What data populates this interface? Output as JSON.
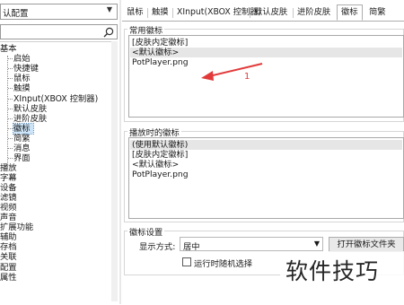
{
  "preset": {
    "value": "认配置"
  },
  "search": {
    "placeholder": ""
  },
  "tree": [
    {
      "label": "基本",
      "indent": 0,
      "sel": false
    },
    {
      "label": "启始",
      "indent": 1,
      "sel": false
    },
    {
      "label": "快捷键",
      "indent": 1,
      "sel": false
    },
    {
      "label": "鼠标",
      "indent": 1,
      "sel": false
    },
    {
      "label": "触摸",
      "indent": 1,
      "sel": false
    },
    {
      "label": "XInput(XBOX 控制器)",
      "indent": 1,
      "sel": false
    },
    {
      "label": "默认皮肤",
      "indent": 1,
      "sel": false
    },
    {
      "label": "进阶皮肤",
      "indent": 1,
      "sel": false
    },
    {
      "label": "徽标",
      "indent": 1,
      "sel": true
    },
    {
      "label": "简繁",
      "indent": 1,
      "sel": false
    },
    {
      "label": "消息",
      "indent": 1,
      "sel": false
    },
    {
      "label": "界面",
      "indent": 1,
      "sel": false
    },
    {
      "label": "播放",
      "indent": 0,
      "sel": false
    },
    {
      "label": "字幕",
      "indent": 0,
      "sel": false
    },
    {
      "label": "设备",
      "indent": 0,
      "sel": false
    },
    {
      "label": "滤镜",
      "indent": 0,
      "sel": false
    },
    {
      "label": "视频",
      "indent": 0,
      "sel": false
    },
    {
      "label": "声音",
      "indent": 0,
      "sel": false
    },
    {
      "label": "扩展功能",
      "indent": 0,
      "sel": false
    },
    {
      "label": "辅助",
      "indent": 0,
      "sel": false
    },
    {
      "label": "存档",
      "indent": 0,
      "sel": false
    },
    {
      "label": "关联",
      "indent": 0,
      "sel": false
    },
    {
      "label": "配置",
      "indent": 0,
      "sel": false
    },
    {
      "label": "属性",
      "indent": 0,
      "sel": false
    }
  ],
  "tabs": [
    {
      "label": "鼠标",
      "active": false
    },
    {
      "label": "触摸",
      "active": false
    },
    {
      "label": "XInput(XBOX 控制器)",
      "active": false
    },
    {
      "label": "默认皮肤",
      "active": false
    },
    {
      "label": "进阶皮肤",
      "active": false
    },
    {
      "label": "徽标",
      "active": true
    },
    {
      "label": "简繁",
      "active": false
    }
  ],
  "common_logos": {
    "title": "常用徽标",
    "items": [
      "[皮肤内定徽标]",
      "<默认徽标>",
      "PotPlayer.png"
    ]
  },
  "annotation": "1",
  "playing_logos": {
    "title": "播放时的徽标",
    "items": [
      "(使用默认徽标)",
      "[皮肤内定徽标]",
      "<默认徽标>",
      "PotPlayer.png"
    ]
  },
  "logo_settings": {
    "title": "徽标设置",
    "display_label": "显示方式:",
    "display_value": "居中",
    "open_button": "打开徽标文件夹",
    "random_checkbox": "运行时随机选择",
    "random_checked": false
  },
  "watermark": "软件技巧",
  "colors": {
    "annotation": "#e23a3a",
    "selection": "#cce4f7"
  }
}
